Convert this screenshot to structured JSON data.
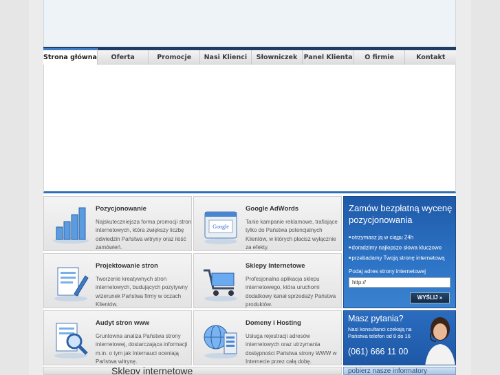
{
  "nav": {
    "items": [
      {
        "label": "Strona główna",
        "active": true
      },
      {
        "label": "Oferta"
      },
      {
        "label": "Promocje"
      },
      {
        "label": "Nasi Klienci"
      },
      {
        "label": "Słowniczek"
      },
      {
        "label": "Panel Klienta"
      },
      {
        "label": "O firmie"
      },
      {
        "label": "Kontakt"
      }
    ]
  },
  "tiles": [
    {
      "title": "Pozycjonowanie",
      "desc": "Najskuteczniejsza forma promocji stron internetowych, która zwiększy liczbę odwiedzin Państwa witryny oraz ilość zamówień.",
      "icon": "bar-chart-icon"
    },
    {
      "title": "Google AdWords",
      "desc": "Tanie kampanie reklamowe, trafiające tylko do Państwa potencjalnych Klientów, w których płacisz wyłącznie za efekty.",
      "icon": "google-window-icon"
    },
    {
      "title": "Projektowanie stron",
      "desc": "Tworzenie kreatywnych stron internetowych, budujących pozytywny wizerunek Państwa firmy w oczach Klientów.",
      "icon": "document-pencil-icon"
    },
    {
      "title": "Sklepy Internetowe",
      "desc": "Profesjonalna aplikacja sklepu internetowego, która uruchomi dodatkowy kanał sprzedaży Państwa produktów.",
      "icon": "shopping-cart-icon"
    },
    {
      "title": "Audyt stron www",
      "desc": "Gruntowna analiza Państwa strony internetowej, dostarczająca informacji m.in. o tym jak Internauci oceniają Państwa witrynę.",
      "icon": "magnifier-document-icon"
    },
    {
      "title": "Domeny i Hosting",
      "desc": "Usługa rejestracji adresów internetowych oraz utrzymania dostępności Państwa strony WWW w Internecie przez całą dobę.",
      "icon": "globe-server-icon"
    }
  ],
  "quote": {
    "title": "Zamów bezpłatną wycenę pozycjonowania",
    "bullets": [
      "otrzymasz ją w ciągu 24h",
      "doradzimy najlepsze słowa kluczowe",
      "przebadamy Twoją stronę internetową"
    ],
    "label": "Podaj adres strony internetowej",
    "input_value": "http://",
    "button": "WYŚLIJ »"
  },
  "help": {
    "title": "Masz pytania?",
    "desc": "Nasi konsultanci czekają na Państwa telefon od 8 do 16",
    "phone": "(061) 666 11 00"
  },
  "bottom": {
    "strip_text": "Sklepy internetowe",
    "side_text": "pobierz nasze informatory"
  },
  "colors": {
    "nav_top": "#1f3d66",
    "accent": "#2f6fb6",
    "tile_icon_blue": "#3d7cc9"
  }
}
